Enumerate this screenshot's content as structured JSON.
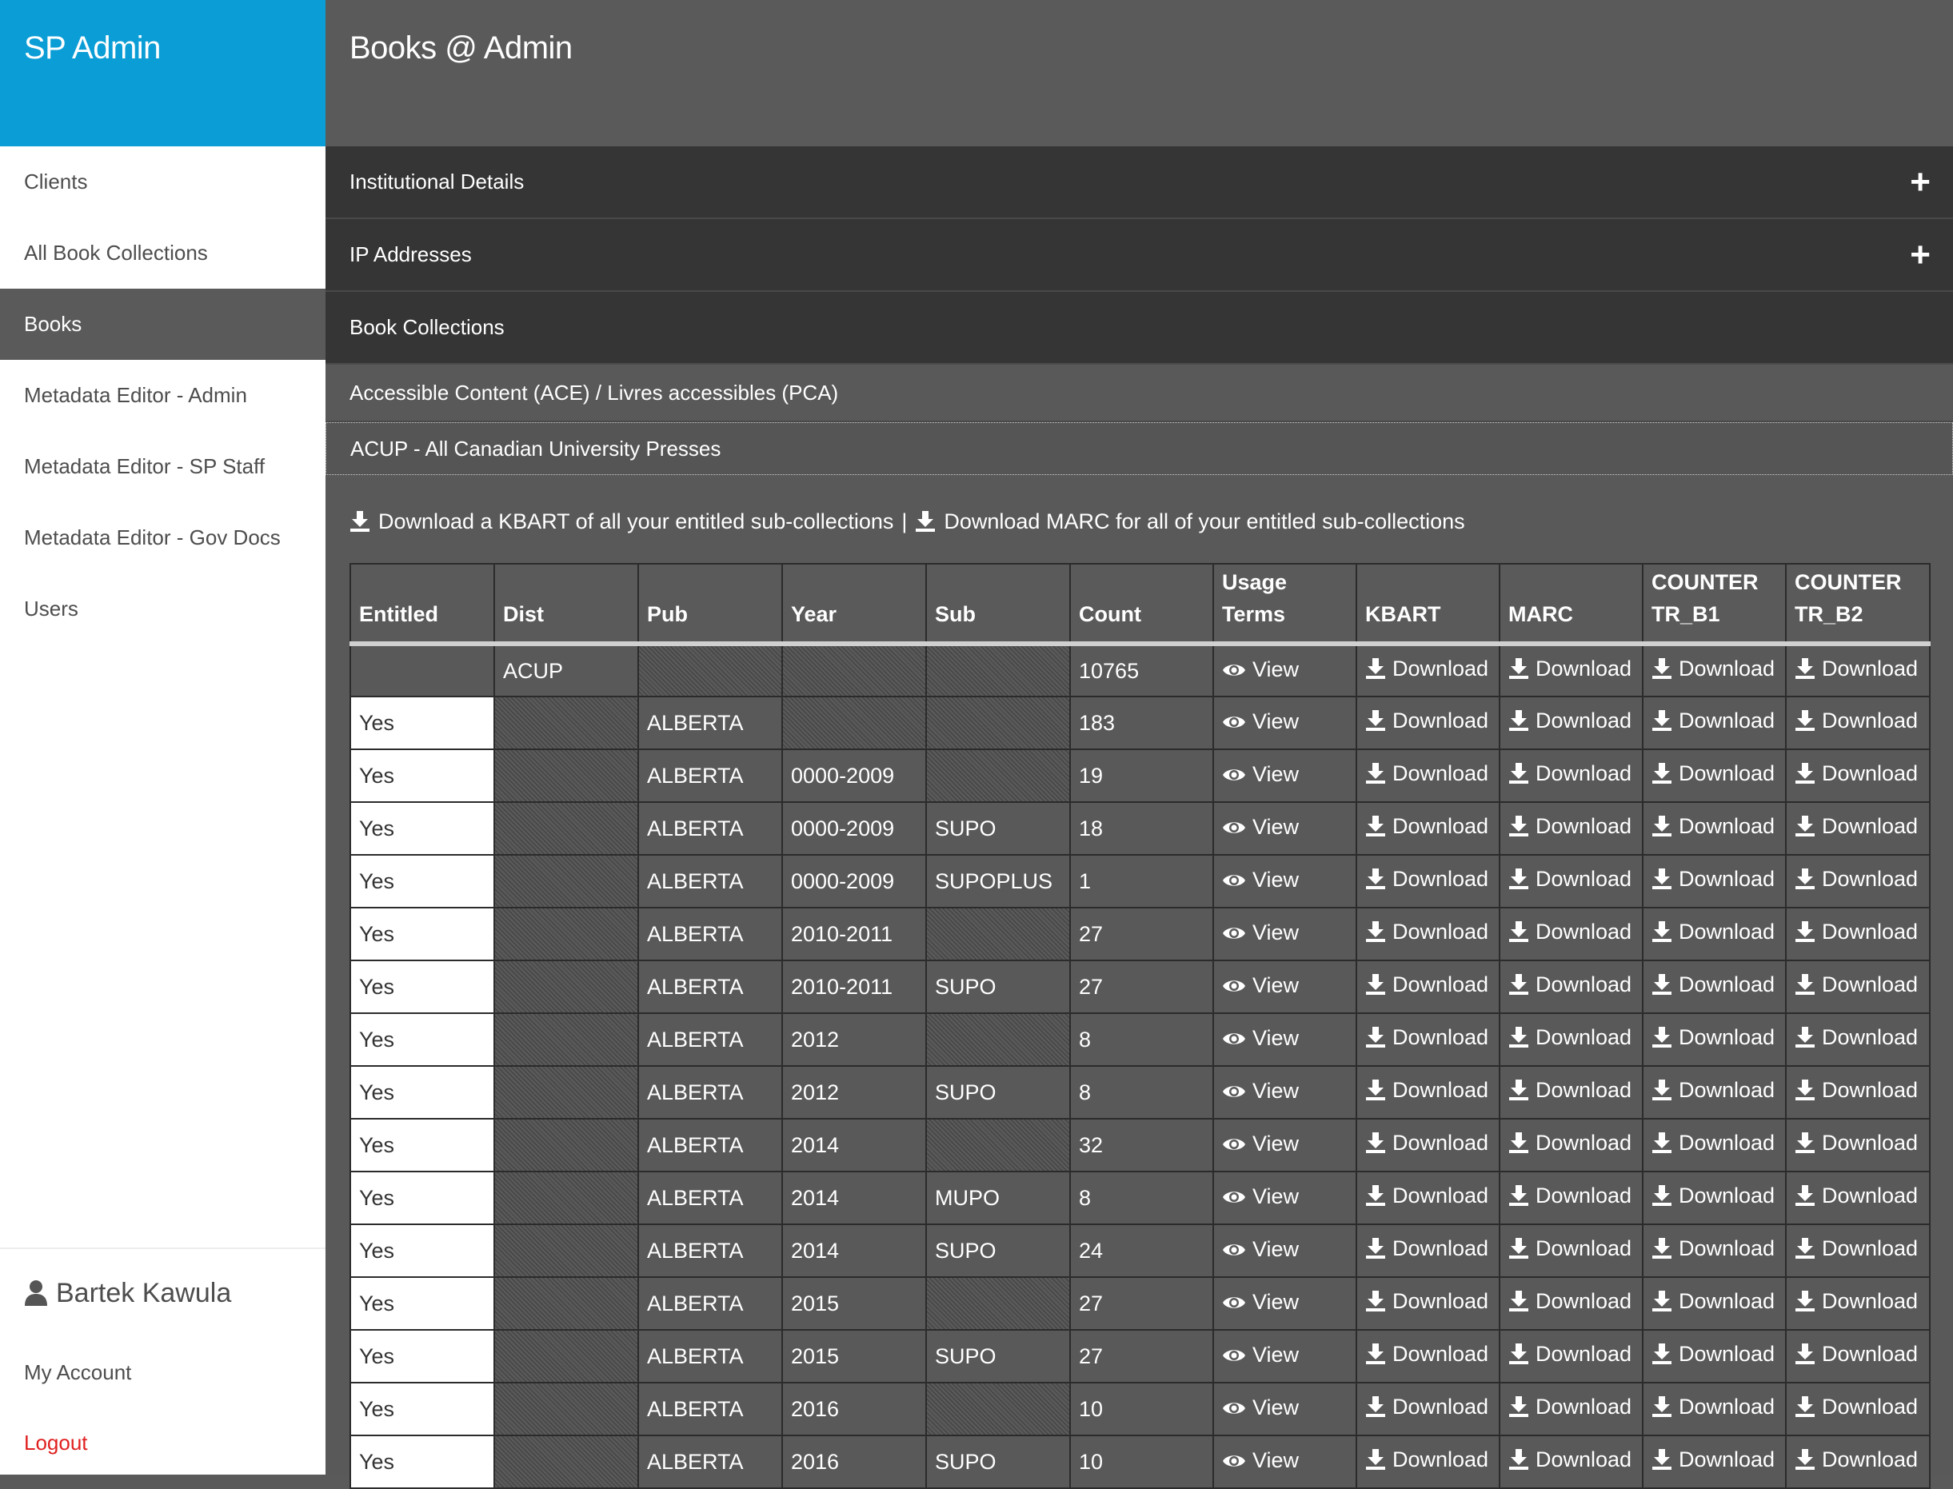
{
  "app": {
    "brand": "SP Admin",
    "page_title": "Books @ Admin"
  },
  "sidebar": {
    "items": [
      {
        "label": "Clients",
        "active": false
      },
      {
        "label": "All Book Collections",
        "active": false
      },
      {
        "label": "Books",
        "active": true
      },
      {
        "label": "Metadata Editor - Admin",
        "active": false
      },
      {
        "label": "Metadata Editor - SP Staff",
        "active": false
      },
      {
        "label": "Metadata Editor - Gov Docs",
        "active": false
      },
      {
        "label": "Users",
        "active": false
      }
    ],
    "user_name": "Bartek Kawula",
    "my_account": "My Account",
    "logout": "Logout"
  },
  "panels": {
    "institutional_details": "Institutional Details",
    "ip_addresses": "IP Addresses",
    "book_collections": "Book Collections",
    "expand_symbol": "+"
  },
  "collections": [
    "Accessible Content (ACE) / Livres accessibles (PCA)",
    "ACUP - All Canadian University Presses"
  ],
  "bulk": {
    "kbart": "Download a KBART of all your entitled sub-collections",
    "separator": "|",
    "marc": "Download MARC for all of your entitled sub-collections"
  },
  "table": {
    "headers": {
      "entitled": "Entitled",
      "dist": "Dist",
      "pub": "Pub",
      "year": "Year",
      "sub": "Sub",
      "count": "Count",
      "usage_line1": "Usage",
      "usage_line2": "Terms",
      "kbart": "KBART",
      "marc": "MARC",
      "tr_b1_line1": "COUNTER",
      "tr_b1_line2": "TR_B1",
      "tr_b2_line1": "COUNTER",
      "tr_b2_line2": "TR_B2"
    },
    "view_label": "View",
    "download_label": "Download",
    "rows": [
      {
        "entitled": "",
        "dist": "ACUP",
        "pub": "",
        "year": "",
        "sub": "",
        "count": "10765"
      },
      {
        "entitled": "Yes",
        "dist": "",
        "pub": "ALBERTA",
        "year": "",
        "sub": "",
        "count": "183"
      },
      {
        "entitled": "Yes",
        "dist": "",
        "pub": "ALBERTA",
        "year": "0000-2009",
        "sub": "",
        "count": "19"
      },
      {
        "entitled": "Yes",
        "dist": "",
        "pub": "ALBERTA",
        "year": "0000-2009",
        "sub": "SUPO",
        "count": "18"
      },
      {
        "entitled": "Yes",
        "dist": "",
        "pub": "ALBERTA",
        "year": "0000-2009",
        "sub": "SUPOPLUS",
        "count": "1"
      },
      {
        "entitled": "Yes",
        "dist": "",
        "pub": "ALBERTA",
        "year": "2010-2011",
        "sub": "",
        "count": "27"
      },
      {
        "entitled": "Yes",
        "dist": "",
        "pub": "ALBERTA",
        "year": "2010-2011",
        "sub": "SUPO",
        "count": "27"
      },
      {
        "entitled": "Yes",
        "dist": "",
        "pub": "ALBERTA",
        "year": "2012",
        "sub": "",
        "count": "8"
      },
      {
        "entitled": "Yes",
        "dist": "",
        "pub": "ALBERTA",
        "year": "2012",
        "sub": "SUPO",
        "count": "8"
      },
      {
        "entitled": "Yes",
        "dist": "",
        "pub": "ALBERTA",
        "year": "2014",
        "sub": "",
        "count": "32"
      },
      {
        "entitled": "Yes",
        "dist": "",
        "pub": "ALBERTA",
        "year": "2014",
        "sub": "MUPO",
        "count": "8"
      },
      {
        "entitled": "Yes",
        "dist": "",
        "pub": "ALBERTA",
        "year": "2014",
        "sub": "SUPO",
        "count": "24"
      },
      {
        "entitled": "Yes",
        "dist": "",
        "pub": "ALBERTA",
        "year": "2015",
        "sub": "",
        "count": "27"
      },
      {
        "entitled": "Yes",
        "dist": "",
        "pub": "ALBERTA",
        "year": "2015",
        "sub": "SUPO",
        "count": "27"
      },
      {
        "entitled": "Yes",
        "dist": "",
        "pub": "ALBERTA",
        "year": "2016",
        "sub": "",
        "count": "10"
      },
      {
        "entitled": "Yes",
        "dist": "",
        "pub": "ALBERTA",
        "year": "2016",
        "sub": "SUPO",
        "count": "10"
      }
    ]
  },
  "colors": {
    "brand": "#0a9dd6",
    "header": "#5a5a5a",
    "panel": "#353535",
    "logout": "#e02020"
  }
}
